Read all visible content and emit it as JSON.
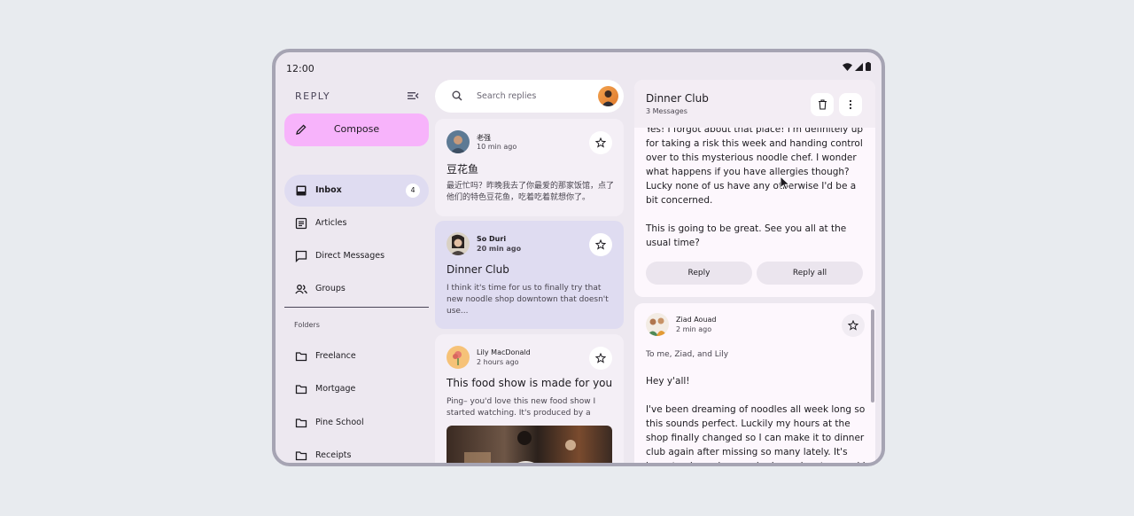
{
  "status": {
    "time": "12:00"
  },
  "nav": {
    "brand": "REPLY",
    "compose": "Compose",
    "items": [
      {
        "label": "Inbox",
        "badge": "4",
        "icon": "inbox-icon"
      },
      {
        "label": "Articles",
        "icon": "article-icon"
      },
      {
        "label": "Direct Messages",
        "icon": "chat-icon"
      },
      {
        "label": "Groups",
        "icon": "groups-icon"
      }
    ],
    "folders_header": "Folders",
    "folders": [
      "Freelance",
      "Mortgage",
      "Pine School",
      "Receipts"
    ]
  },
  "search": {
    "placeholder": "Search replies"
  },
  "emails": [
    {
      "sender": "老强",
      "time": "10 min ago",
      "subject": "豆花鱼",
      "preview": "最近忙吗？昨晚我去了你最爱的那家饭馆，点了他们的特色豆花鱼，吃着吃着就想你了。"
    },
    {
      "sender": "So Duri",
      "time": "20 min ago",
      "subject": "Dinner Club",
      "preview": "I think it's time for us to finally try that new noodle shop downtown that doesn't use..."
    },
    {
      "sender": "Lily MacDonald",
      "time": "2 hours ago",
      "subject": "This food show is made for you",
      "preview": "Ping– you'd love this new food show I started watching. It's produced by a Thai..."
    }
  ],
  "detail": {
    "title": "Dinner Club",
    "count": "3 Messages",
    "body1": "Yes! I forgot about that place! I'm definitely up for taking a risk this week and handing control over to this mysterious noodle chef. I wonder what happens if you have allergies though? Lucky none of us have any otherwise I'd be a bit concerned.",
    "body2": "This is going to be great. See you all at the usual time?",
    "reply": "Reply",
    "reply_all": "Reply all",
    "second": {
      "sender": "Ziad Aouad",
      "time": "2 min ago",
      "to": "To me, Ziad, and Lily",
      "greeting": "Hey y'all!",
      "body": "I've been dreaming of noodles all week long so this sounds perfect. Luckily my hours at the shop finally changed so I can make it to dinner club again after missing so many lately. It's been too long since we had an adventure and I have a feeling this is going"
    }
  }
}
